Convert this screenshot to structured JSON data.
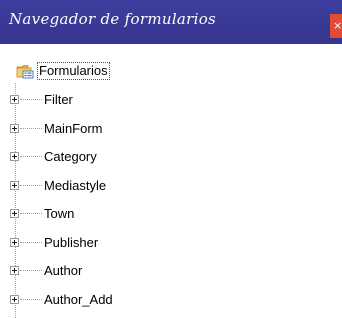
{
  "window": {
    "title": "Navegador de formularios",
    "close_label": "×"
  },
  "tree": {
    "root": {
      "label": "Formularios",
      "icon": "forms-folder-icon"
    },
    "items": [
      {
        "label": "Filter"
      },
      {
        "label": "MainForm"
      },
      {
        "label": "Category"
      },
      {
        "label": "Mediastyle"
      },
      {
        "label": "Town"
      },
      {
        "label": "Publisher"
      },
      {
        "label": "Author"
      },
      {
        "label": "Author_Add"
      }
    ]
  }
}
